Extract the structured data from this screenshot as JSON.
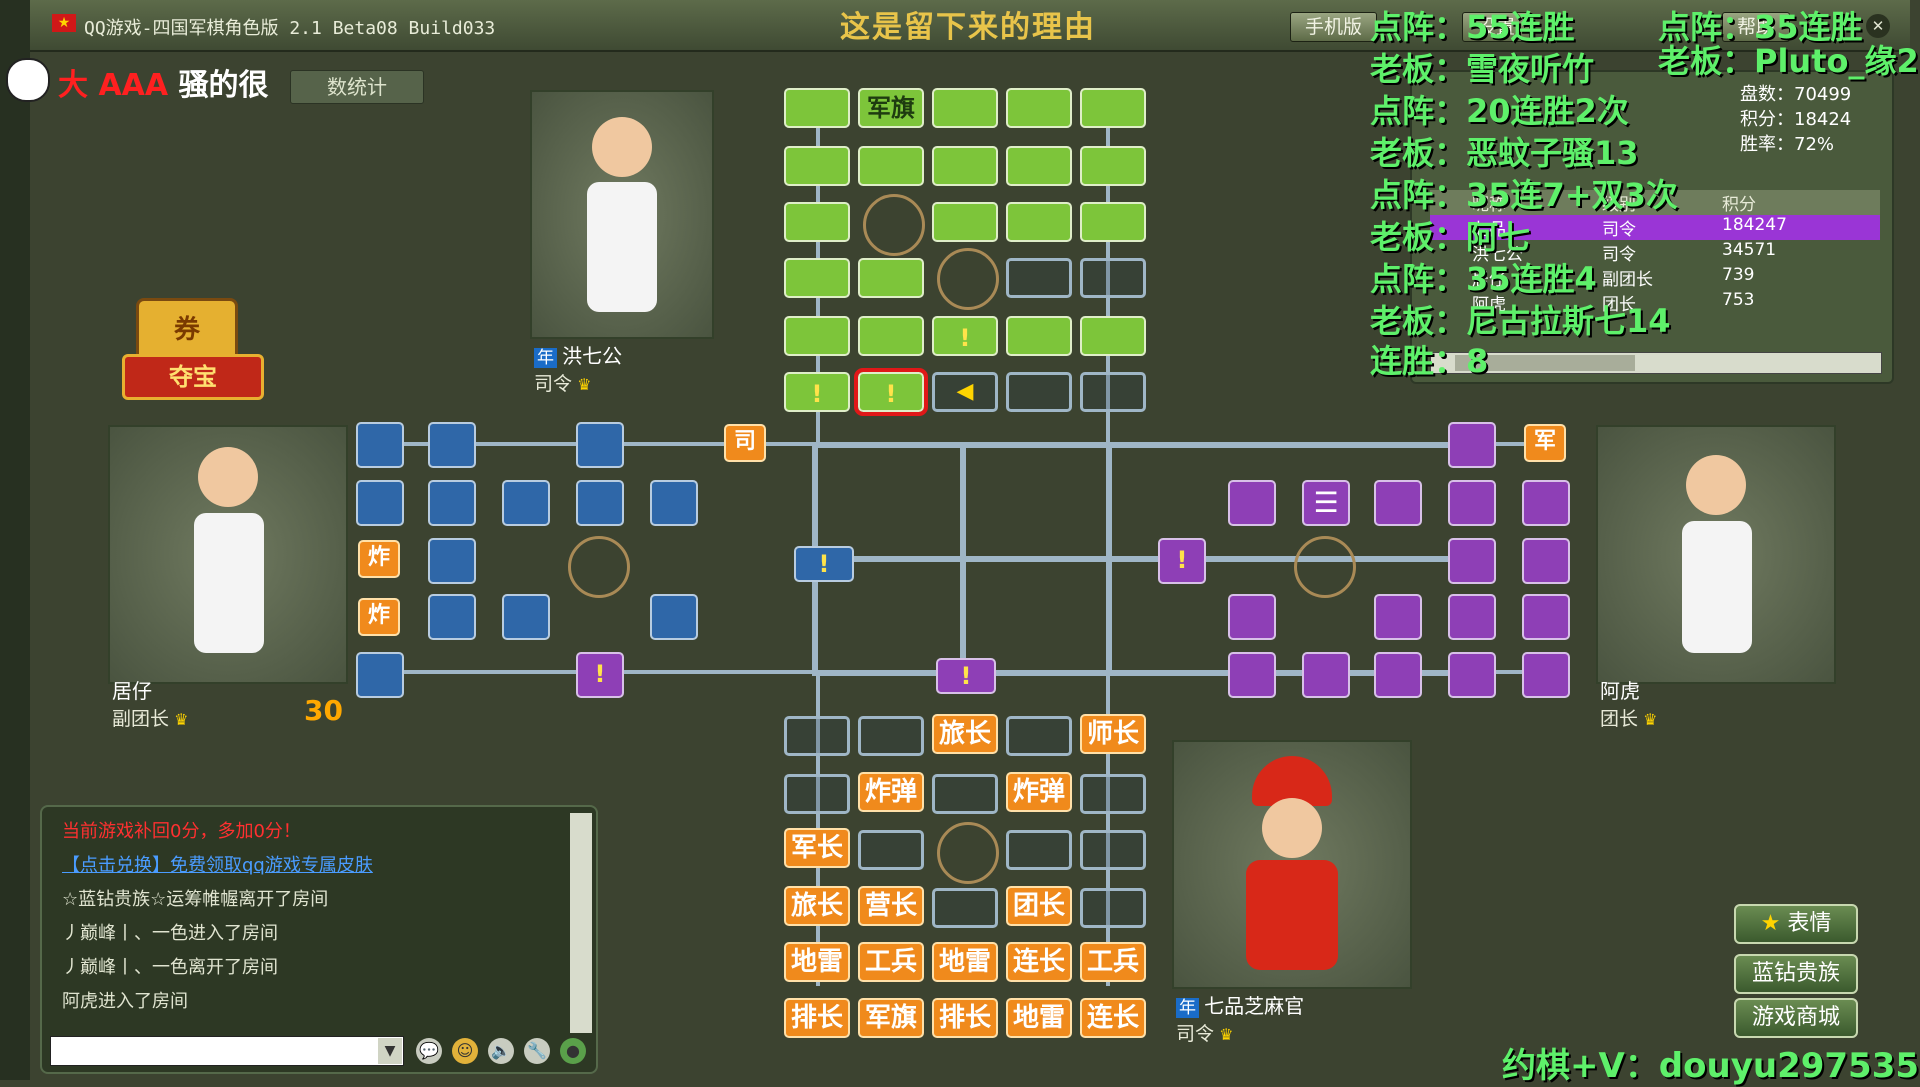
{
  "window": {
    "title": "QQ游戏-四国军棋角色版 2.1 Beta08 Build033",
    "banner": "这是留下来的理由",
    "buttons": [
      "手机版",
      "设置",
      "帮助"
    ],
    "close": "✕"
  },
  "player_header": {
    "name_red": "大 AAA",
    "name_white": "骚的很",
    "stats_tab": "数统计"
  },
  "treasure": {
    "label": "夺宝",
    "ticket": "券"
  },
  "players": {
    "top": {
      "name": "洪七公",
      "rank": "司令",
      "badge": "年"
    },
    "left": {
      "name": "居仔",
      "rank": "副团长",
      "number": "30"
    },
    "right": {
      "name": "阿虎",
      "rank": "团长"
    },
    "bottom": {
      "name": "七品芝麻官",
      "rank": "司令",
      "badge": "年"
    }
  },
  "board": {
    "top_flag": "军旗",
    "bottom_pieces": {
      "r1": [
        "旅长",
        "师长"
      ],
      "r2": [
        "炸弹",
        "炸弹"
      ],
      "r3": [
        "军长"
      ],
      "r4": [
        "旅长",
        "营长",
        "团长"
      ],
      "r5": [
        "地雷",
        "工兵",
        "地雷",
        "连长",
        "工兵"
      ],
      "r6": [
        "排长",
        "军旗",
        "排长",
        "地雷",
        "连长"
      ]
    },
    "left_pieces": [
      "司",
      "炸",
      "炸"
    ],
    "right_pieces": [
      "军"
    ],
    "bang": "!",
    "arrow": "◀"
  },
  "overlay_left": [
    "点阵：55连胜",
    "老板：雪夜听竹",
    "点阵：20连胜2次",
    "老板：恶蚊子骚13",
    "点阵：35连7+双3次",
    "老板：阿七",
    "点阵：35连胜4",
    "老板：尼古拉斯七14",
    "连胜：8"
  ],
  "overlay_right": [
    "点阵：35连胜",
    "老板：Pluto_缘2"
  ],
  "info": {
    "stats": [
      "盘数：70499",
      "积分：18424",
      "胜率：72%"
    ],
    "table_head": [
      "昵称",
      "级别",
      "积分"
    ],
    "rows": [
      {
        "name": "七品...",
        "rank": "司令",
        "score": "184247",
        "selected": true
      },
      {
        "name": "洪七公",
        "rank": "司令",
        "score": "34571"
      },
      {
        "name": "居仔",
        "rank": "副团长",
        "score": "739"
      },
      {
        "name": "阿虎",
        "rank": "团长",
        "score": "753"
      }
    ]
  },
  "chat": {
    "lines": [
      {
        "text": "当前游戏补回0分，多加0分！",
        "color": "#ff3030"
      },
      {
        "text": "【点击兑换】免费领取qq游戏专属皮肤",
        "color": "#4a9cff"
      },
      {
        "text": "☆蓝钻贵族☆运筹帷幄离开了房间",
        "color": "#e0e4d0"
      },
      {
        "text": "丿巅峰丨、一色进入了房间",
        "color": "#e0e4d0"
      },
      {
        "text": "丿巅峰丨、一色离开了房间",
        "color": "#e0e4d0"
      },
      {
        "text": "阿虎进入了房间",
        "color": "#e0e4d0"
      }
    ]
  },
  "right_buttons": [
    "表情",
    "蓝钻贵族",
    "游戏商城"
  ],
  "contact": "约棋+V：douyu297535"
}
